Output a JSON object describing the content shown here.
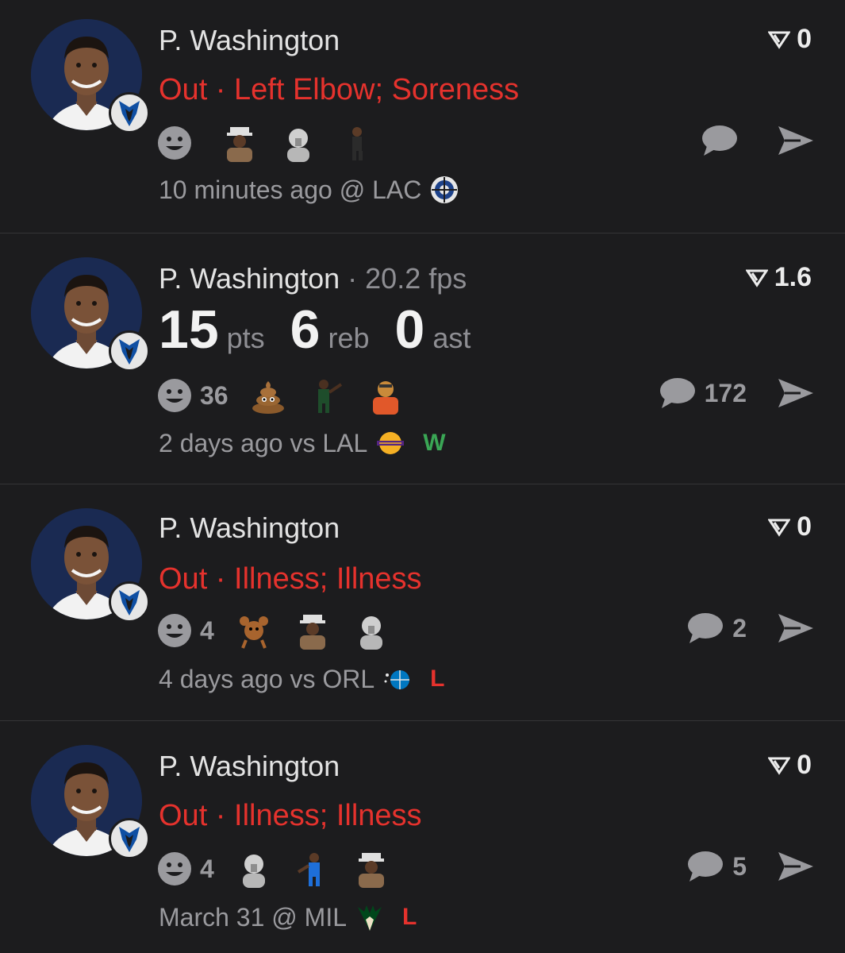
{
  "colors": {
    "background": "#1c1c1e",
    "injury_red": "#e5322d",
    "win_green": "#3aa655",
    "muted": "#9a9a9e"
  },
  "posts": [
    {
      "player_name": "P. Washington",
      "team_icon": "mavericks-logo-icon",
      "score": "0",
      "type": "status",
      "status_text": "Out · Left Elbow; Soreness",
      "reaction_count": "",
      "reaction_emojis": [
        "sticker-man-hat-icon",
        "sticker-gray-figure-icon",
        "sticker-dancing-man-icon"
      ],
      "comment_count": "",
      "time": "10 minutes ago",
      "location": "@ LAC",
      "opponent_icon": "clippers-logo-icon",
      "result": ""
    },
    {
      "player_name": "P. Washington",
      "fps": "· 20.2 fps",
      "team_icon": "mavericks-logo-icon",
      "score": "1.6",
      "type": "stats",
      "stats": [
        {
          "value": "15",
          "unit": "pts"
        },
        {
          "value": "6",
          "unit": "reb"
        },
        {
          "value": "0",
          "unit": "ast"
        }
      ],
      "reaction_count": "36",
      "reaction_emojis": [
        "poop-emoji-icon",
        "sticker-player-pointing-icon",
        "sticker-man-orange-icon"
      ],
      "comment_count": "172",
      "time": "2 days ago",
      "location": "vs LAL",
      "opponent_icon": "lakers-logo-icon",
      "result": "W"
    },
    {
      "player_name": "P. Washington",
      "team_icon": "mavericks-logo-icon",
      "score": "0",
      "type": "status",
      "status_text": "Out · Illness; Illness",
      "reaction_count": "4",
      "reaction_emojis": [
        "sticker-cartoon-mouse-icon",
        "sticker-man-hat-icon",
        "sticker-gray-figure-icon"
      ],
      "comment_count": "2",
      "time": "4 days ago",
      "location": "vs ORL",
      "opponent_icon": "magic-logo-icon",
      "result": "L"
    },
    {
      "player_name": "P. Washington",
      "team_icon": "mavericks-logo-icon",
      "score": "0",
      "type": "status",
      "status_text": "Out · Illness; Illness",
      "reaction_count": "4",
      "reaction_emojis": [
        "sticker-gray-figure-icon",
        "sticker-player-blue-icon",
        "sticker-man-hat-icon"
      ],
      "comment_count": "5",
      "time": "March 31",
      "location": "@ MIL",
      "opponent_icon": "bucks-logo-icon",
      "result": "L"
    }
  ]
}
